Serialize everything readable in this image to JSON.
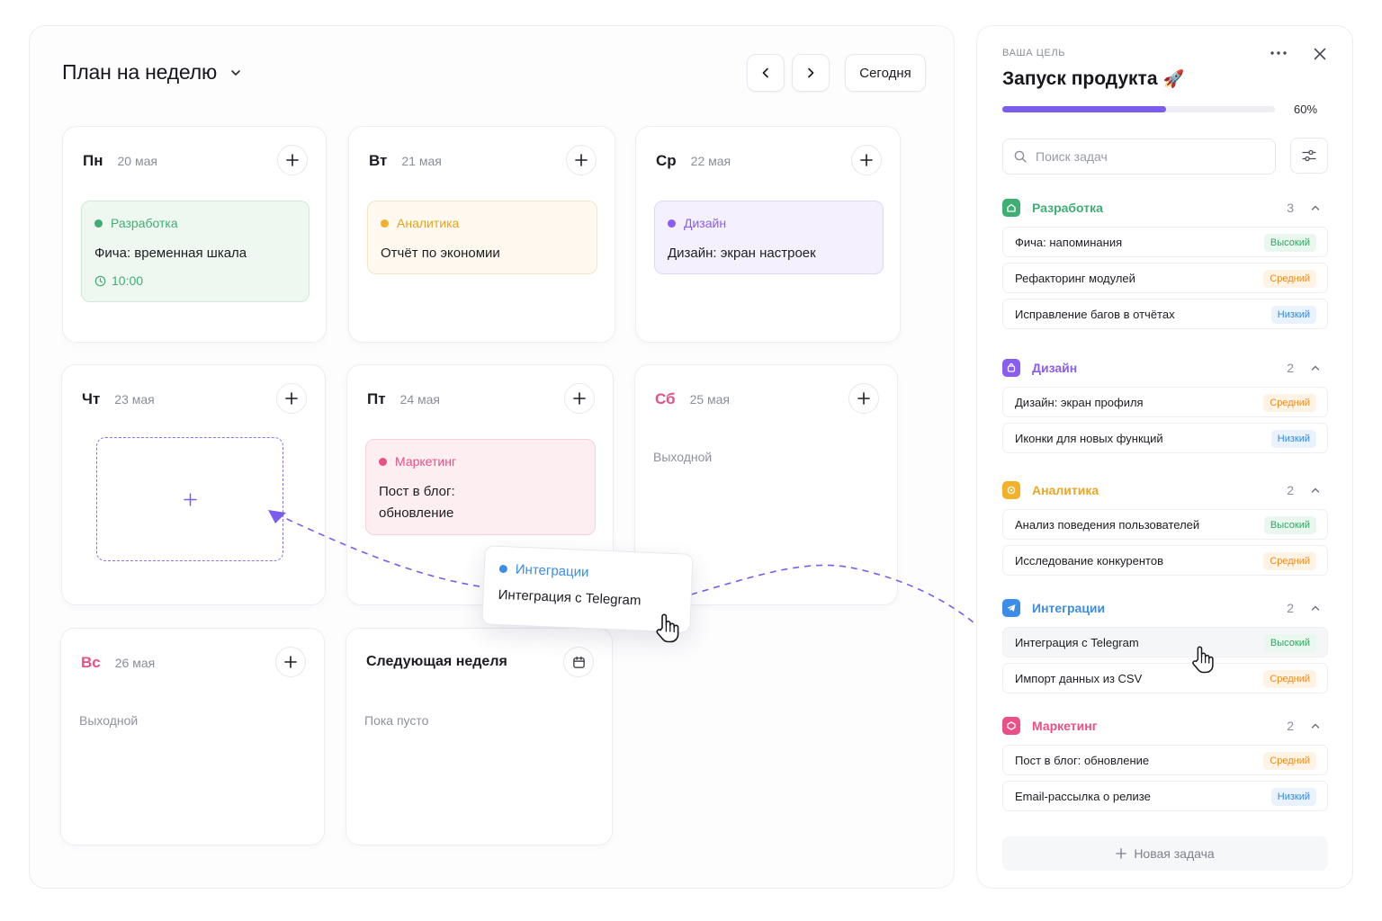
{
  "planner": {
    "title": "План на неделю",
    "today_label": "Сегодня",
    "days": [
      {
        "name": "Пн",
        "date": "20 мая"
      },
      {
        "name": "Вт",
        "date": "21 мая"
      },
      {
        "name": "Ср",
        "date": "22 мая"
      },
      {
        "name": "Чт",
        "date": "23 мая"
      },
      {
        "name": "Пт",
        "date": "24 мая"
      },
      {
        "name": "Сб",
        "date": "25 мая",
        "note": "Выходной"
      },
      {
        "name": "Вс",
        "date": "26 мая",
        "note": "Выходной"
      }
    ],
    "next_week": {
      "title": "Следующая неделя",
      "note": "Пока пусто"
    },
    "tasks": {
      "mon": {
        "category": "Разработка",
        "title": "Фича: временная шкала",
        "time": "10:00"
      },
      "tue": {
        "category": "Аналитика",
        "title": "Отчёт по экономии"
      },
      "wed": {
        "category": "Дизайн",
        "title": "Дизайн: экран настроек"
      },
      "fri": {
        "category": "Маркетинг",
        "title_line1": "Пост в блог:",
        "title_line2": "обновление"
      }
    },
    "dragging": {
      "category": "Интеграции",
      "title": "Интеграция с Telegram"
    }
  },
  "goal": {
    "label": "ВАША ЦЕЛЬ",
    "title": "Запуск продукта",
    "emoji": "🚀",
    "progress_percent": 60,
    "progress_label": "60%",
    "search_placeholder": "Поиск задач",
    "new_task_label": "Новая задача",
    "groups": [
      {
        "name": "Разработка",
        "count": "3",
        "tasks": [
          {
            "title": "Фича: напоминания",
            "priority": "Высокий"
          },
          {
            "title": "Рефакторинг модулей",
            "priority": "Средний"
          },
          {
            "title": "Исправление багов в отчётах",
            "priority": "Низкий"
          }
        ]
      },
      {
        "name": "Дизайн",
        "count": "2",
        "tasks": [
          {
            "title": "Дизайн: экран профиля",
            "priority": "Средний"
          },
          {
            "title": "Иконки для новых функций",
            "priority": "Низкий"
          }
        ]
      },
      {
        "name": "Аналитика",
        "count": "2",
        "tasks": [
          {
            "title": "Анализ поведения пользователей",
            "priority": "Высокий"
          },
          {
            "title": "Исследование конкурентов",
            "priority": "Средний"
          }
        ]
      },
      {
        "name": "Интеграции",
        "count": "2",
        "tasks": [
          {
            "title": "Интеграция с Telegram",
            "priority": "Высокий"
          },
          {
            "title": "Импорт данных из CSV",
            "priority": "Средний"
          }
        ]
      },
      {
        "name": "Маркетинг",
        "count": "2",
        "tasks": [
          {
            "title": "Пост в блог: обновление",
            "priority": "Средний"
          },
          {
            "title": "Email-рассылка о релизе",
            "priority": "Низкий"
          }
        ]
      }
    ]
  },
  "colors": {
    "accent": "#7b5ced",
    "development": "#3fae74",
    "design": "#8a5cf0",
    "analytics": "#f2b12b",
    "integrations": "#3b8de8",
    "marketing": "#ea4f86"
  }
}
